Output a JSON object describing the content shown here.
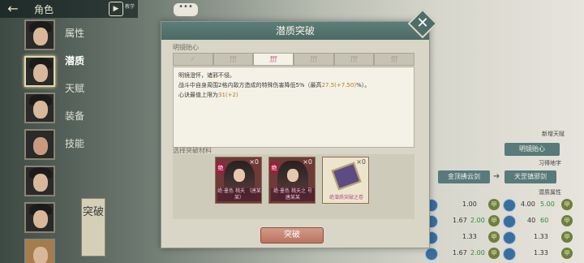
{
  "top_bar": {
    "title": "角色",
    "back_icon": "back-arrow-icon",
    "play_text": "教学",
    "chat": "•••"
  },
  "sidebar_menu": [
    "属性",
    "潜质",
    "天赋",
    "装备",
    "技能"
  ],
  "sidebar_active": "潜质",
  "side_breakthrough": "突破",
  "modal": {
    "title": "潜质突破",
    "section1_label": "明镜贻心",
    "tabs": [
      "✓",
      "ƒƒƒ",
      "ƒƒƒ",
      "ƒƒƒ",
      "ƒƒƒ",
      "ƒƒƒ"
    ],
    "desc": {
      "line1": "明镜澄怀，诸邪不侵。",
      "line2_a": "战斗中自身周围2格内敌方造成的特殊伤害降低5%（最高",
      "line2_hl": "27.5(+7.50)",
      "line2_b": "%）。",
      "line3_a": "心诀最值上限为",
      "line3_hl": "31(+2)"
    },
    "section2_label": "选择突破材料",
    "materials": [
      {
        "count": "×0",
        "name": "绝·墨色 桃夭 （唐某某）",
        "tag": "绝"
      },
      {
        "count": "×0",
        "name": "绝·墨色 桃夭之 号 唐某某",
        "tag": "绝"
      },
      {
        "count": "×0",
        "name": "绝潜质突破之卷",
        "tag": ""
      }
    ],
    "button": "突破"
  },
  "right_panel": {
    "new_talent_label": "新增天赋",
    "new_talent_value": "明镜贻心",
    "learned_label": "习得地字",
    "from": "金顶拂云剑",
    "to": "天罡镇邪剑",
    "attr_label": "潜质属性",
    "stats": [
      {
        "left_val": "1.00",
        "right_val": "4.00",
        "right_up": "5.00"
      },
      {
        "left_val": "1.67",
        "left_up": "2.00",
        "right_val": "40",
        "right_up": "60"
      },
      {
        "left_val": "1.33",
        "right_val": "1.33"
      },
      {
        "left_val": "1.67",
        "left_up": "2.00",
        "right_val": "1.33"
      }
    ],
    "badge": "甲"
  }
}
